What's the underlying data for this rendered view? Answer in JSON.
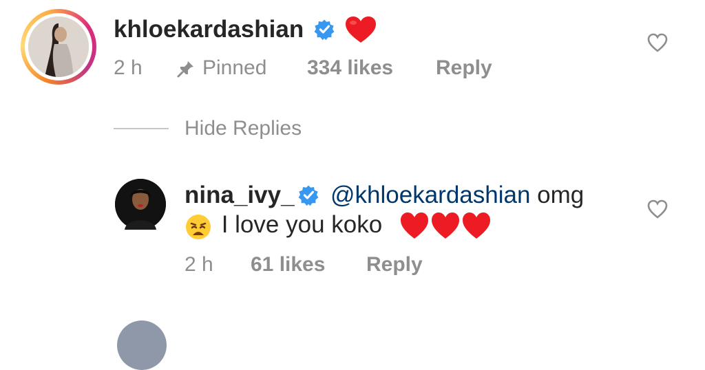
{
  "comment": {
    "username": "khloekardashian",
    "verified": true,
    "text_emoji": "❤️",
    "time": "2 h",
    "pinned_label": "Pinned",
    "likes": "334 likes",
    "reply_label": "Reply",
    "has_story": true
  },
  "replies_toggle": {
    "label": "Hide Replies"
  },
  "reply": {
    "username": "nina_ivy_",
    "verified": true,
    "mention": "@khloekardashian",
    "text_line1_rest": " omg",
    "emoji_weary": "😩",
    "text_line2": " I love you koko ",
    "hearts": "❤️❤️❤️",
    "time": "2 h",
    "likes": "61 likes",
    "reply_label": "Reply"
  },
  "icons": {
    "like": "heart-outline-icon",
    "pin": "pin-icon",
    "verified": "verified-badge-icon"
  },
  "colors": {
    "verified": "#3897f0",
    "meta": "#8e8e8e",
    "mention": "#00376b",
    "heart": "#ed1c24"
  }
}
